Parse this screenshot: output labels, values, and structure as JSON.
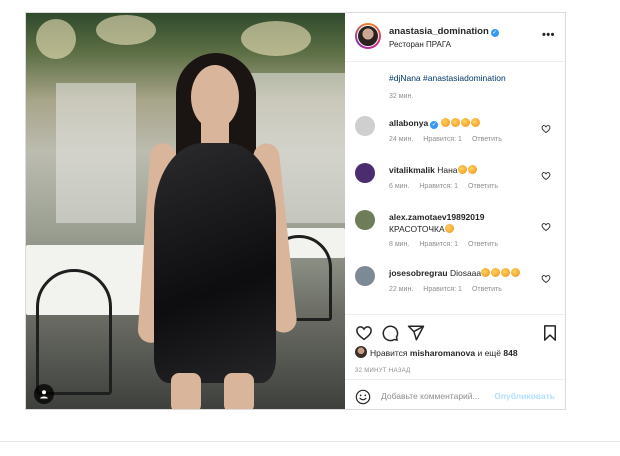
{
  "post": {
    "username": "anastasia_domination",
    "location": "Ресторан ПРАГА",
    "more_icon": "more-icon",
    "caption": "#djNana #anastasiadomination",
    "caption_time": "32 мин."
  },
  "comments": [
    {
      "user": "allabonya",
      "verified": true,
      "text": "",
      "emoji_count": 4,
      "time": "24 мин.",
      "likes": "Нравится: 1",
      "reply": "Ответить",
      "avatar_color": "#cfcfcf"
    },
    {
      "user": "vitalikmalik",
      "verified": false,
      "text": "Нана",
      "emoji_count": 2,
      "time": "6 мин.",
      "likes": "Нравится: 1",
      "reply": "Ответить",
      "avatar_color": "#4b2c6e"
    },
    {
      "user": "alex.zamotaev19892019",
      "verified": false,
      "text": "КРАСОТОЧКА",
      "emoji_count": 1,
      "time": "8 мин.",
      "likes": "Нравится: 1",
      "reply": "Ответить",
      "avatar_color": "#6f7c5a"
    },
    {
      "user": "josesobregrau",
      "verified": false,
      "text": "Diosaaa",
      "emoji_count": 4,
      "time": "22 мин.",
      "likes": "Нравится: 1",
      "reply": "Ответить",
      "avatar_color": "#7d8a96"
    }
  ],
  "likes": {
    "prefix": "Нравится",
    "user": "misharomanova",
    "suffix": "и ещё",
    "count": "848"
  },
  "post_time": "32 МИНУТ НАЗАД",
  "comment_box": {
    "placeholder": "Добавьте комментарий...",
    "publish": "Опубликовать"
  },
  "colors": {
    "link": "#00376b",
    "verified": "#3897f0",
    "meta": "#8e8e8e",
    "publish_disabled": "#b2dffc"
  }
}
